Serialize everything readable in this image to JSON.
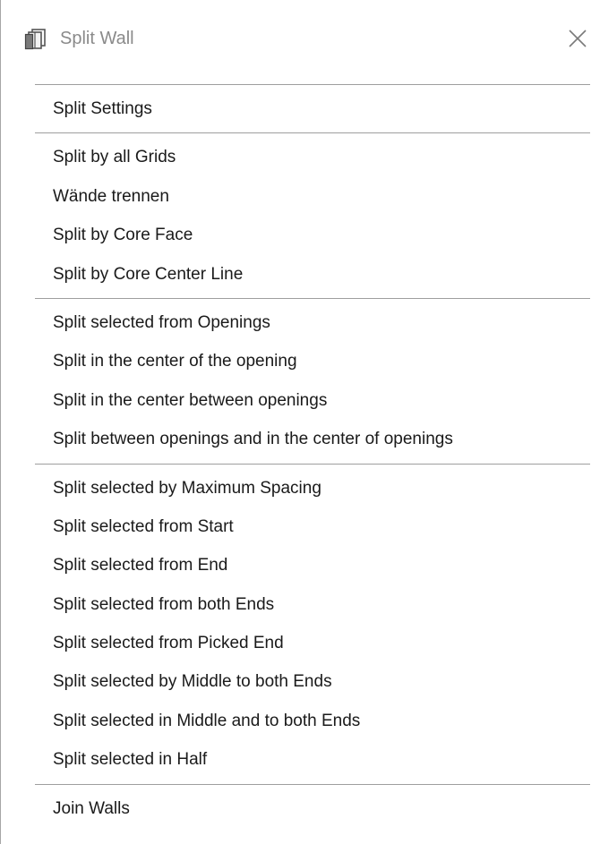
{
  "window": {
    "title": "Split Wall",
    "title_icon": "wall-split-icon",
    "close_icon": "close-icon"
  },
  "menu": {
    "groups": [
      {
        "items": [
          "Split Settings"
        ]
      },
      {
        "items": [
          "Split by all Grids",
          "Wände trennen",
          "Split by Core Face",
          "Split by Core Center Line"
        ]
      },
      {
        "items": [
          "Split selected from Openings",
          "Split in the center of the opening",
          "Split in the center between openings",
          "Split between openings and in the center of openings"
        ]
      },
      {
        "items": [
          "Split selected by Maximum Spacing",
          "Split selected from Start",
          "Split selected from End",
          "Split selected from both Ends",
          "Split selected from Picked End",
          "Split selected by Middle to both Ends",
          "Split selected in Middle and to both Ends",
          "Split selected in Half"
        ]
      },
      {
        "items": [
          "Join Walls"
        ]
      }
    ]
  }
}
